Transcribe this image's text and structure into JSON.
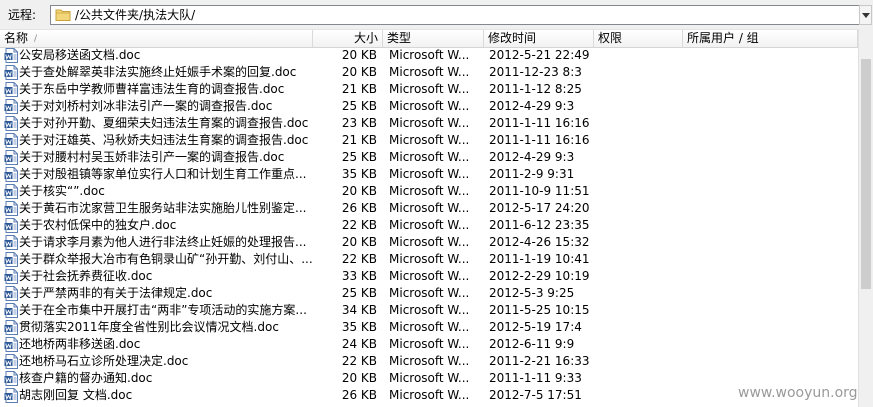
{
  "pathbar": {
    "label": "远程:",
    "path": "/公共文件夹/执法大队/"
  },
  "columns": {
    "name": "名称",
    "size": "大小",
    "type": "类型",
    "modified": "修改时间",
    "permissions": "权限",
    "owner": "所属用户 / 组"
  },
  "files": [
    {
      "name": "公安局移送函文档.doc",
      "size": "20 KB",
      "type": "Microsoft W...",
      "date": "2012-5-21 22:49"
    },
    {
      "name": "关于查处解翠英非法实施终止妊娠手术案的回复.doc",
      "size": "20 KB",
      "type": "Microsoft W...",
      "date": "2011-12-23 8:3"
    },
    {
      "name": "关于东岳中学教师曹祥富违法生育的调查报告.doc",
      "size": "21 KB",
      "type": "Microsoft W...",
      "date": "2011-1-12 8:25"
    },
    {
      "name": "关于对刘桥村刘冰非法引产一案的调查报告.doc",
      "size": "25 KB",
      "type": "Microsoft W...",
      "date": "2012-4-29 9:3"
    },
    {
      "name": "关于对孙开勤、夏细荣夫妇违法生育案的调查报告.doc",
      "size": "23 KB",
      "type": "Microsoft W...",
      "date": "2011-1-11 16:16"
    },
    {
      "name": "关于对汪雄英、冯秋娇夫妇违法生育案的调查报告.doc",
      "size": "21 KB",
      "type": "Microsoft W...",
      "date": "2011-1-11 16:16"
    },
    {
      "name": "关于对腰村村吴玉娇非法引产一案的调查报告.doc",
      "size": "25 KB",
      "type": "Microsoft W...",
      "date": "2012-4-29 9:3"
    },
    {
      "name": "关于对殷祖镇等家单位实行人口和计划生育工作重点...",
      "size": "35 KB",
      "type": "Microsoft W...",
      "date": "2011-2-9 9:31"
    },
    {
      "name": "关于核实“”.doc",
      "size": "20 KB",
      "type": "Microsoft W...",
      "date": "2011-10-9 11:51"
    },
    {
      "name": "关于黄石市沈家营卫生服务站非法实施胎儿性别鉴定...",
      "size": "26 KB",
      "type": "Microsoft W...",
      "date": "2012-5-17 24:20"
    },
    {
      "name": "关于农村低保中的独女户.doc",
      "size": "22 KB",
      "type": "Microsoft W...",
      "date": "2011-6-12 23:35"
    },
    {
      "name": "关于请求李月素为他人进行非法终止妊娠的处理报告...",
      "size": "20 KB",
      "type": "Microsoft W...",
      "date": "2012-4-26 15:32"
    },
    {
      "name": "关于群众举报大冶市有色铜录山矿“孙开勤、刘付山、...",
      "size": "22 KB",
      "type": "Microsoft W...",
      "date": "2011-1-19 10:41"
    },
    {
      "name": "关于社会抚养费征收.doc",
      "size": "33 KB",
      "type": "Microsoft W...",
      "date": "2012-2-29 10:19"
    },
    {
      "name": "关于严禁两非的有关于法律规定.doc",
      "size": "25 KB",
      "type": "Microsoft W...",
      "date": "2012-5-3 9:25"
    },
    {
      "name": "关于在全市集中开展打击“两非”专项活动的实施方案...",
      "size": "34 KB",
      "type": "Microsoft W...",
      "date": "2011-5-25 10:15"
    },
    {
      "name": "贯彻落实2011年度全省性别比会议情况文档.doc",
      "size": "35 KB",
      "type": "Microsoft W...",
      "date": "2012-5-19 17:4"
    },
    {
      "name": "还地桥两非移送函.doc",
      "size": "24 KB",
      "type": "Microsoft W...",
      "date": "2012-6-11 9:9"
    },
    {
      "name": "还地桥马石立诊所处理决定.doc",
      "size": "22 KB",
      "type": "Microsoft W...",
      "date": "2011-2-21 16:33"
    },
    {
      "name": "核查户籍的督办通知.doc",
      "size": "20 KB",
      "type": "Microsoft W...",
      "date": "2011-1-11 9:33"
    },
    {
      "name": "胡志刚回复 文档.doc",
      "size": "26 KB",
      "type": "Microsoft W...",
      "date": "2012-7-5 17:51"
    }
  ],
  "watermark": "www.wooyun.org",
  "colors": {
    "doc_icon_blue": "#2b5797",
    "folder_yellow": "#e8c55a"
  }
}
